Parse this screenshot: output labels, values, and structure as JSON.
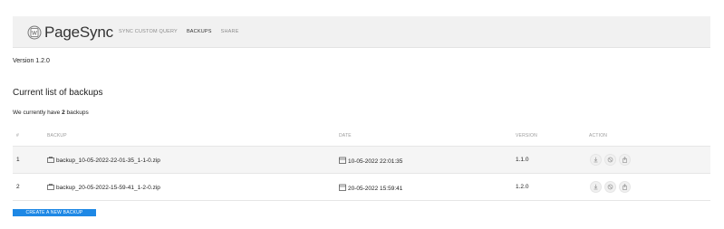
{
  "header": {
    "logo_text": "PageSync",
    "nav": [
      {
        "label": "SYNC CUSTOM QUERY"
      },
      {
        "label": "BACKUPS"
      },
      {
        "label": "SHARE"
      }
    ]
  },
  "version_text": "Version 1.2.0",
  "section_title": "Current list of backups",
  "summary": {
    "prefix": "We currently have ",
    "count": "2",
    "suffix": " backups"
  },
  "table": {
    "columns": [
      "#",
      "BACKUP",
      "DATE",
      "VERSION",
      "ACTION"
    ],
    "rows": [
      {
        "num": "1",
        "backup": "backup_10-05-2022-22-01-35_1-1-0.zip",
        "date": "10-05-2022 22:01:35",
        "version": "1.1.0"
      },
      {
        "num": "2",
        "backup": "backup_20-05-2022-15-59-41_1-2-0.zip",
        "date": "20-05-2022 15:59:41",
        "version": "1.2.0"
      }
    ]
  },
  "create_button_label": "CREATE A NEW BACKUP",
  "colors": {
    "accent": "#1e88e5",
    "topbar_bg": "#f1f1f1",
    "row_shaded": "#f5f5f5"
  },
  "icons": {
    "logo": "pagesync-logo-icon",
    "file": "briefcase-icon",
    "date": "calendar-icon",
    "actions": [
      "download-icon",
      "restore-icon",
      "share-icon"
    ]
  }
}
